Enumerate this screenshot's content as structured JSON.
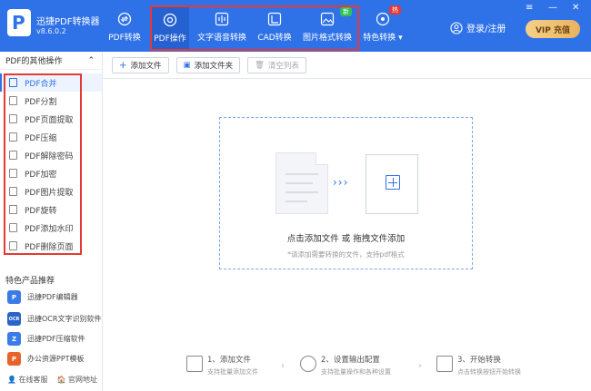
{
  "app": {
    "name": "迅捷PDF转换器",
    "version": "v8.6.0.2"
  },
  "nav": [
    {
      "label": "PDF转换"
    },
    {
      "label": "PDF操作"
    },
    {
      "label": "文字语音转换"
    },
    {
      "label": "CAD转换"
    },
    {
      "label": "图片格式转换",
      "badge": "新"
    },
    {
      "label": "特色转换 ▾",
      "badge": "热"
    }
  ],
  "header": {
    "login": "登录/注册",
    "vip": "VIP 充值"
  },
  "sidebar": {
    "title": "PDF的其他操作",
    "items": [
      {
        "label": "PDF合并"
      },
      {
        "label": "PDF分割"
      },
      {
        "label": "PDF页面提取"
      },
      {
        "label": "PDF压缩"
      },
      {
        "label": "PDF解除密码"
      },
      {
        "label": "PDF加密"
      },
      {
        "label": "PDF图片提取"
      },
      {
        "label": "PDF旋转"
      },
      {
        "label": "PDF添加水印"
      },
      {
        "label": "PDF删除页面"
      }
    ],
    "promo_title": "特色产品推荐",
    "promos": [
      {
        "label": "迅捷PDF编辑器",
        "icon": "P",
        "color": "#3a7be8"
      },
      {
        "label": "迅捷OCR文字识别软件",
        "icon": "OCR",
        "color": "#2a63c9"
      },
      {
        "label": "迅捷PDF压缩软件",
        "icon": "Z",
        "color": "#3a7be8"
      },
      {
        "label": "办公资源PPT模板",
        "icon": "P",
        "color": "#e8632a"
      }
    ],
    "links": [
      "在线客服",
      "官网地址"
    ]
  },
  "toolbar": {
    "add_file": "添加文件",
    "add_folder": "添加文件夹",
    "clear": "清空列表"
  },
  "dropzone": {
    "main": "点击添加文件 或 拖拽文件添加",
    "sub": "*请添加需要转换的文件，支持pdf格式"
  },
  "steps": [
    {
      "title": "1、添加文件",
      "desc": "支持批量添加文件"
    },
    {
      "title": "2、设置输出配置",
      "desc": "支持批量操作和各种设置"
    },
    {
      "title": "3、开始转换",
      "desc": "点击转换按钮开始转换"
    }
  ]
}
